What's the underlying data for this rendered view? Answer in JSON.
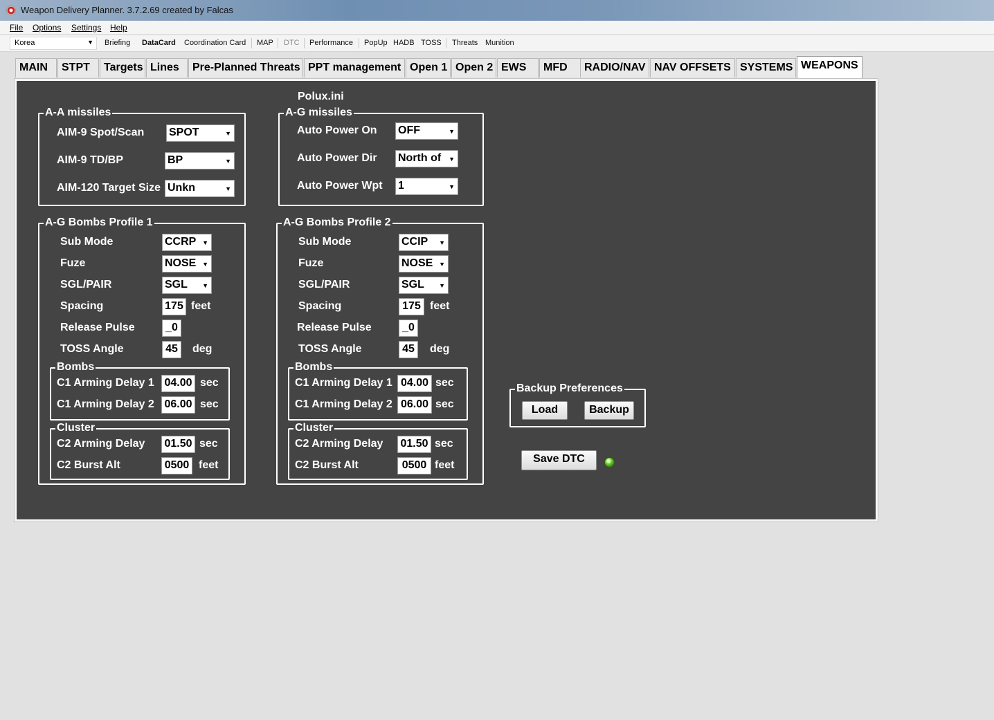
{
  "window": {
    "title": "Weapon Delivery Planner. 3.7.2.69 created by Falcas"
  },
  "menu": [
    "File",
    "Options",
    "Settings",
    "Help"
  ],
  "toolbar": {
    "theater": "Korea",
    "items": [
      "Briefing",
      "DataCard",
      "Coordination Card",
      "MAP",
      "DTC",
      "Performance",
      "PopUp",
      "HADB",
      "TOSS",
      "Threats",
      "Munition"
    ]
  },
  "tabs": [
    "MAIN",
    "STPT",
    "Targets",
    "Lines",
    "Pre-Planned Threats",
    "PPT management",
    "Open 1",
    "Open 2",
    "EWS",
    "MFD",
    "RADIO/NAV",
    "NAV OFFSETS",
    "SYSTEMS",
    "WEAPONS"
  ],
  "active_tab": "WEAPONS",
  "ini_file": "Polux.ini",
  "aa_missiles": {
    "title": "A-A missiles",
    "aim9_spot_label": "AIM-9 Spot/Scan",
    "aim9_spot": "SPOT",
    "aim9_tdbp_label": "AIM-9 TD/BP",
    "aim9_tdbp": "BP",
    "aim120_size_label": "AIM-120 Target Size",
    "aim120_size": "Unkn"
  },
  "ag_missiles": {
    "title": "A-G missiles",
    "auto_power_on_label": "Auto Power On",
    "auto_power_on": "OFF",
    "auto_power_dir_label": "Auto Power Dir",
    "auto_power_dir": "North of",
    "auto_power_wpt_label": "Auto Power Wpt",
    "auto_power_wpt": "1"
  },
  "profile1": {
    "title": "A-G Bombs Profile 1",
    "submode_label": "Sub Mode",
    "submode": "CCRP",
    "fuze_label": "Fuze",
    "fuze": "NOSE",
    "sgl_label": "SGL/PAIR",
    "sgl": "SGL",
    "spacing_label": "Spacing",
    "spacing": "175",
    "spacing_unit": "feet",
    "pulse_label": "Release Pulse",
    "pulse": "_0",
    "toss_label": "TOSS Angle",
    "toss": "45",
    "toss_unit": "deg",
    "bombs_title": "Bombs",
    "c1d1_label": "C1 Arming Delay 1",
    "c1d1": "04.00",
    "c1d1_unit": "sec",
    "c1d2_label": "C1 Arming Delay 2",
    "c1d2": "06.00",
    "c1d2_unit": "sec",
    "cluster_title": "Cluster",
    "c2d_label": "C2 Arming Delay",
    "c2d": "01.50",
    "c2d_unit": "sec",
    "c2alt_label": "C2 Burst Alt",
    "c2alt": "0500",
    "c2alt_unit": "feet"
  },
  "profile2": {
    "title": "A-G Bombs Profile 2",
    "submode_label": "Sub Mode",
    "submode": "CCIP",
    "fuze_label": "Fuze",
    "fuze": "NOSE",
    "sgl_label": "SGL/PAIR",
    "sgl": "SGL",
    "spacing_label": "Spacing",
    "spacing": "175",
    "spacing_unit": "feet",
    "pulse_label": "Release Pulse",
    "pulse": "_0",
    "toss_label": "TOSS Angle",
    "toss": "45",
    "toss_unit": "deg",
    "bombs_title": "Bombs",
    "c1d1_label": "C1 Arming Delay 1",
    "c1d1": "04.00",
    "c1d1_unit": "sec",
    "c1d2_label": "C1 Arming Delay 2",
    "c1d2": "06.00",
    "c1d2_unit": "sec",
    "cluster_title": "Cluster",
    "c2d_label": "C2 Arming Delay",
    "c2d": "01.50",
    "c2d_unit": "sec",
    "c2alt_label": "C2 Burst Alt",
    "c2alt": "0500",
    "c2alt_unit": "feet"
  },
  "backup": {
    "title": "Backup Preferences",
    "load_label": "Load",
    "backup_label": "Backup"
  },
  "save_dtc_label": "Save DTC",
  "colors": {
    "panel": "#444444",
    "led": "#7ad23a"
  }
}
